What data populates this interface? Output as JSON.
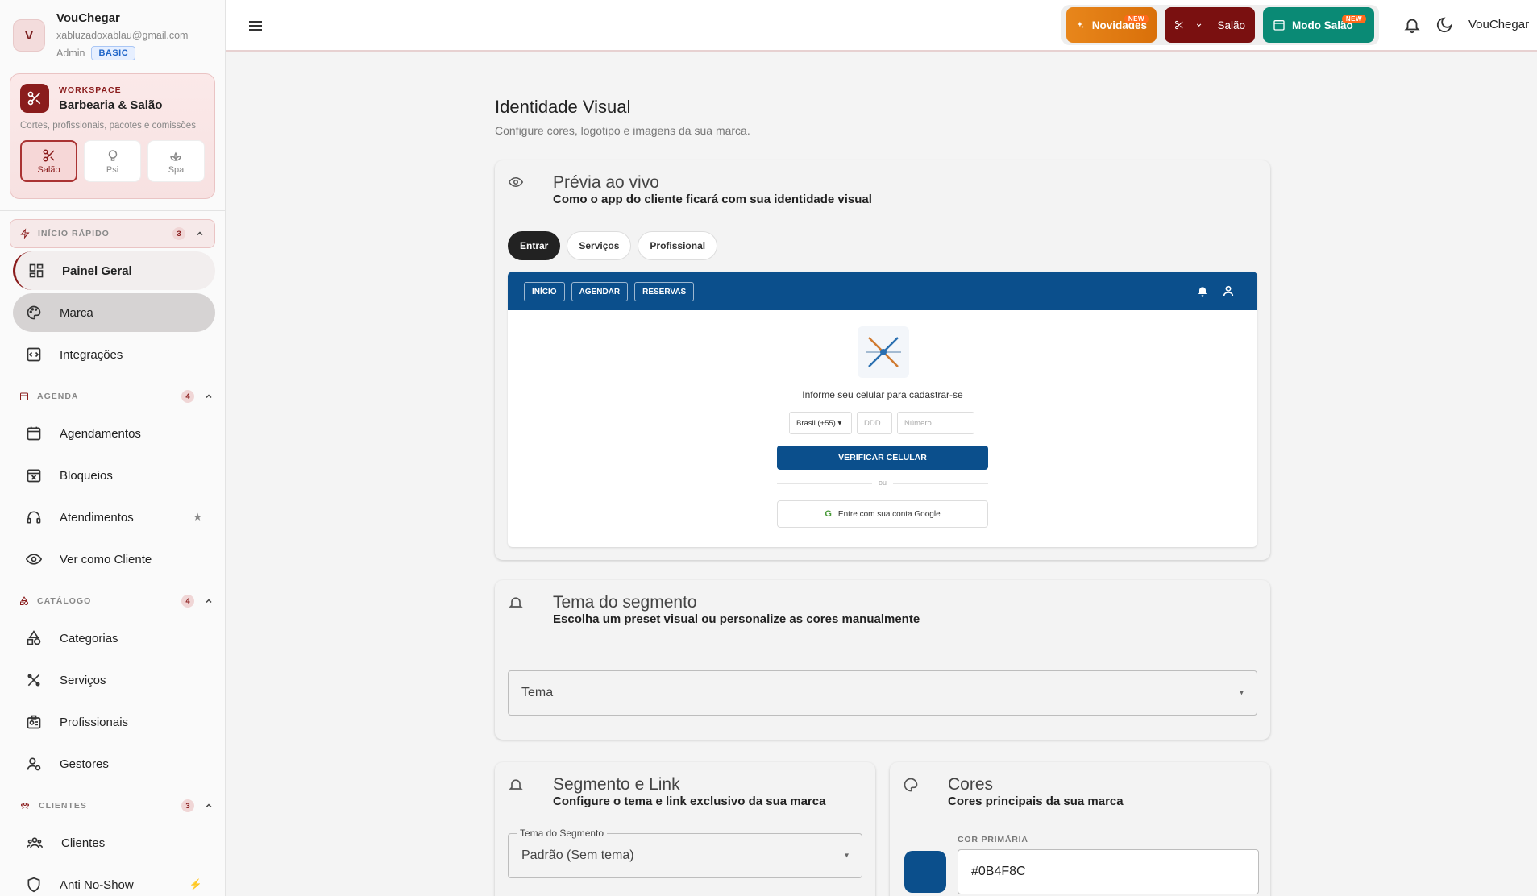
{
  "user": {
    "initial": "V",
    "name": "VouChegar",
    "email": "xabluzadoxablau@gmail.com",
    "role": "Admin",
    "plan": "BASIC"
  },
  "workspace": {
    "label": "WORKSPACE",
    "name": "Barbearia & Salão",
    "description": "Cortes, profissionais, pacotes e comissões",
    "modes": [
      "Salão",
      "Psi",
      "Spa"
    ]
  },
  "sections": {
    "quick": {
      "title": "INÍCIO RÁPIDO",
      "count": "3"
    },
    "agenda": {
      "title": "AGENDA",
      "count": "4"
    },
    "catalog": {
      "title": "CATÁLOGO",
      "count": "4"
    },
    "clients": {
      "title": "CLIENTES",
      "count": "3"
    }
  },
  "nav": {
    "painel": "Painel Geral",
    "marca": "Marca",
    "integracoes": "Integrações",
    "agendamentos": "Agendamentos",
    "bloqueios": "Bloqueios",
    "atendimentos": "Atendimentos",
    "ver_cliente": "Ver como Cliente",
    "categorias": "Categorias",
    "servicos": "Serviços",
    "profissionais": "Profissionais",
    "gestores": "Gestores",
    "clientes": "Clientes",
    "anti_no_show": "Anti No-Show"
  },
  "topbar": {
    "novidades": "Novidades",
    "salao": "Salão",
    "modo_salao": "Modo Salão",
    "new_badge": "NEW",
    "username": "VouChegar"
  },
  "page": {
    "title": "Identidade Visual",
    "subtitle": "Configure cores, logotipo e imagens da sua marca."
  },
  "preview_card": {
    "title": "Prévia ao vivo",
    "subtitle": "Como o app do cliente ficará com sua identidade visual",
    "tabs": [
      "Entrar",
      "Serviços",
      "Profissional"
    ],
    "app_nav": [
      "INÍCIO",
      "AGENDAR",
      "RESERVAS"
    ],
    "prompt": "Informe seu celular para cadastrar-se",
    "country": "Brasil (+55) ▾",
    "ddd_placeholder": "DDD",
    "number_placeholder": "Número",
    "verify_button": "VERIFICAR CELULAR",
    "or_text": "ou",
    "google_button": "Entre com sua conta Google"
  },
  "theme_card": {
    "title": "Tema do segmento",
    "subtitle": "Escolha um preset visual ou personalize as cores manualmente",
    "select_label": "Tema"
  },
  "segment_card": {
    "title": "Segmento e Link",
    "subtitle": "Configure o tema e link exclusivo da sua marca",
    "field_label": "Tema do Segmento",
    "field_value": "Padrão (Sem tema)"
  },
  "colors_card": {
    "title": "Cores",
    "subtitle": "Cores principais da sua marca",
    "primary_label": "COR PRIMÁRIA",
    "primary_value": "#0B4F8C"
  },
  "colors": {
    "brand": "#8a1c1c",
    "primary": "#0B4F8C",
    "teal": "#0a8a75",
    "orange": "#e8861b"
  }
}
